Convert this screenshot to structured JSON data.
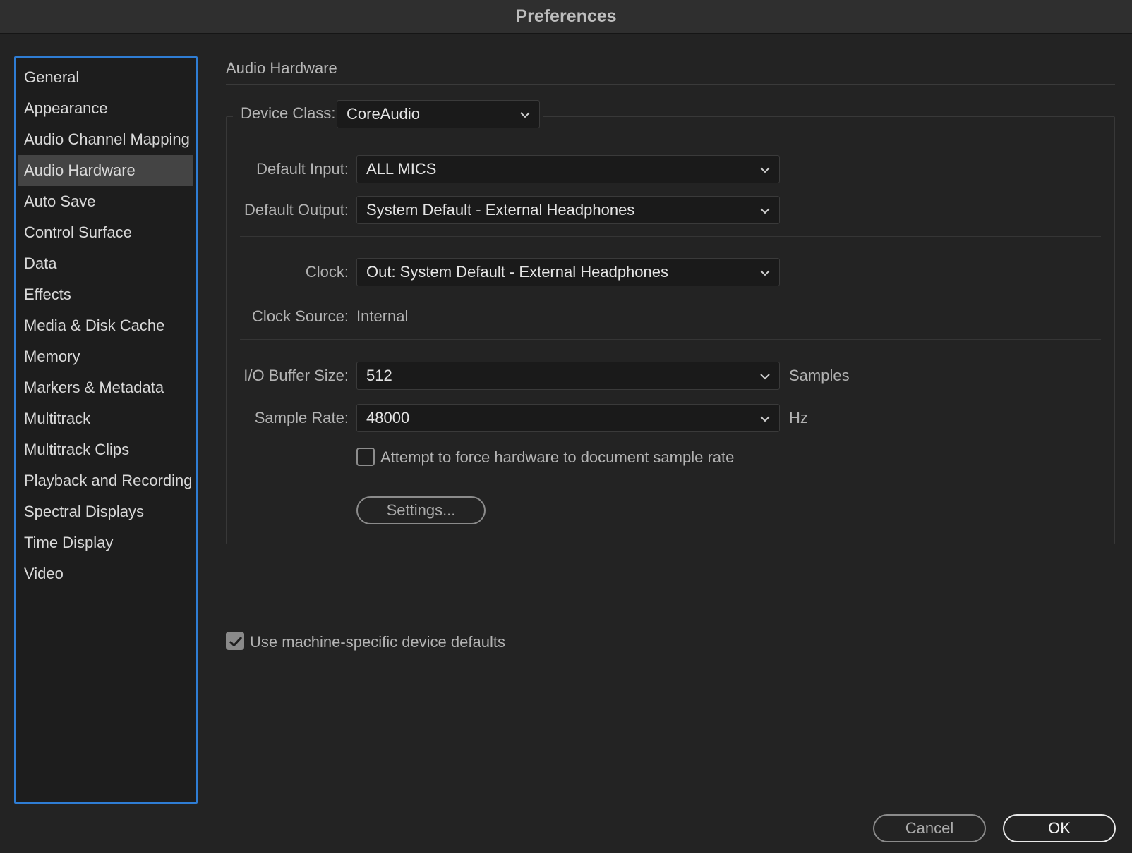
{
  "window": {
    "title": "Preferences"
  },
  "sidebar": {
    "items": [
      {
        "label": "General"
      },
      {
        "label": "Appearance"
      },
      {
        "label": "Audio Channel Mapping"
      },
      {
        "label": "Audio Hardware",
        "selected": true
      },
      {
        "label": "Auto Save"
      },
      {
        "label": "Control Surface"
      },
      {
        "label": "Data"
      },
      {
        "label": "Effects"
      },
      {
        "label": "Media & Disk Cache"
      },
      {
        "label": "Memory"
      },
      {
        "label": "Markers & Metadata"
      },
      {
        "label": "Multitrack"
      },
      {
        "label": "Multitrack Clips"
      },
      {
        "label": "Playback and Recording"
      },
      {
        "label": "Spectral Displays"
      },
      {
        "label": "Time Display"
      },
      {
        "label": "Video"
      }
    ]
  },
  "main": {
    "section_title": "Audio Hardware",
    "device_class": {
      "label": "Device Class:",
      "value": "CoreAudio"
    },
    "default_input": {
      "label": "Default Input:",
      "value": "ALL MICS"
    },
    "default_output": {
      "label": "Default Output:",
      "value": "System Default - External Headphones"
    },
    "clock": {
      "label": "Clock:",
      "value": "Out: System Default - External Headphones"
    },
    "clock_source": {
      "label": "Clock Source:",
      "value": "Internal"
    },
    "io_buffer_size": {
      "label": "I/O Buffer Size:",
      "value": "512",
      "unit": "Samples"
    },
    "sample_rate": {
      "label": "Sample Rate:",
      "value": "48000",
      "unit": "Hz"
    },
    "force_sample_rate": {
      "label": "Attempt to force hardware to document sample rate",
      "checked": false
    },
    "settings_button": "Settings...",
    "machine_defaults": {
      "label": "Use machine-specific device defaults",
      "checked": true
    }
  },
  "footer": {
    "cancel_label": "Cancel",
    "ok_label": "OK"
  },
  "colors": {
    "accent": "#2f7dd4",
    "background": "#232323",
    "selected": "#444444"
  },
  "icons": {
    "dropdown": "chevron-down-icon",
    "check": "checkmark-icon"
  }
}
